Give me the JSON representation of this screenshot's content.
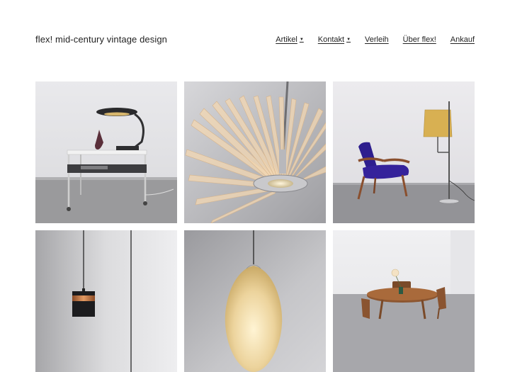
{
  "site": {
    "title": "flex! mid-century vintage design"
  },
  "nav": {
    "items": [
      {
        "label": "Artikel",
        "has_dropdown": true
      },
      {
        "label": "Kontakt",
        "has_dropdown": true
      },
      {
        "label": "Verleih",
        "has_dropdown": false
      },
      {
        "label": "Über flex!",
        "has_dropdown": false
      },
      {
        "label": "Ankauf",
        "has_dropdown": false
      }
    ],
    "dropdown_glyph": "▼"
  },
  "gallery": {
    "items": [
      {
        "name": "desk-lamp-on-serving-cart"
      },
      {
        "name": "acrylic-fin-pendant-lamp"
      },
      {
        "name": "blue-lounge-chair-and-floor-lamp"
      },
      {
        "name": "black-copper-pendant-lamp"
      },
      {
        "name": "glass-egg-pendant-lamp"
      },
      {
        "name": "round-teak-dining-set"
      }
    ]
  }
}
